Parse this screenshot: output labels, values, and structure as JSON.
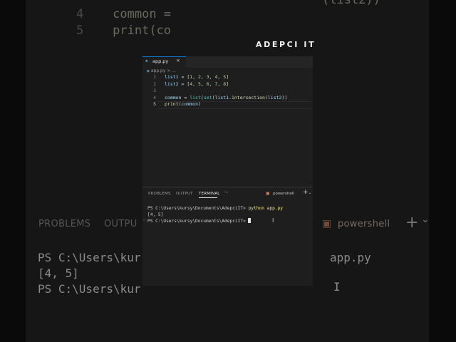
{
  "background": {
    "code_lines": [
      {
        "number": "4",
        "text": "common = "
      },
      {
        "number": "5",
        "text": "print(co"
      }
    ],
    "code_tail": "(list2))",
    "panel_tabs": [
      "PROBLEMS",
      "OUTPU"
    ],
    "powershell_label": "powershell",
    "plus_label": "+",
    "chevron": "⌄",
    "terminal_lines": [
      "PS C:\\Users\\kur",
      "[4, 5]",
      "PS C:\\Users\\kur"
    ],
    "terminal_tail": "app.py",
    "ibeam": "I"
  },
  "watermark": "ADEPCI IT",
  "editor": {
    "tab": {
      "icon": "python-file-icon",
      "label": "app.py",
      "close": "×"
    },
    "breadcrumb": {
      "file": "app.py",
      "rest": "> ..."
    },
    "lines": [
      {
        "number": "1",
        "parts": [
          [
            "var",
            "list1"
          ],
          [
            "op",
            " = ["
          ],
          [
            "num",
            "1"
          ],
          [
            "op",
            ", "
          ],
          [
            "num",
            "2"
          ],
          [
            "op",
            ", "
          ],
          [
            "num",
            "3"
          ],
          [
            "op",
            ", "
          ],
          [
            "num",
            "4"
          ],
          [
            "op",
            ", "
          ],
          [
            "num",
            "5"
          ],
          [
            "op",
            "]"
          ]
        ]
      },
      {
        "number": "2",
        "parts": [
          [
            "var",
            "list2"
          ],
          [
            "op",
            " = ["
          ],
          [
            "num",
            "4"
          ],
          [
            "op",
            ", "
          ],
          [
            "num",
            "5"
          ],
          [
            "op",
            ", "
          ],
          [
            "num",
            "6"
          ],
          [
            "op",
            ", "
          ],
          [
            "num",
            "7"
          ],
          [
            "op",
            ", "
          ],
          [
            "num",
            "8"
          ],
          [
            "op",
            "]"
          ]
        ]
      },
      {
        "number": "3",
        "parts": []
      },
      {
        "number": "4",
        "parts": [
          [
            "var",
            "common"
          ],
          [
            "op",
            " = "
          ],
          [
            "cls",
            "list"
          ],
          [
            "op",
            "("
          ],
          [
            "cls",
            "set"
          ],
          [
            "op",
            "("
          ],
          [
            "var",
            "list1"
          ],
          [
            "op",
            "."
          ],
          [
            "fn",
            "intersection"
          ],
          [
            "op",
            "("
          ],
          [
            "var",
            "list2"
          ],
          [
            "op",
            "))"
          ]
        ]
      },
      {
        "number": "5",
        "parts": [
          [
            "fn",
            "print"
          ],
          [
            "op",
            "("
          ],
          [
            "var",
            "common"
          ],
          [
            "op",
            ")"
          ]
        ]
      }
    ],
    "active_line": 5
  },
  "panel": {
    "tabs": [
      "PROBLEMS",
      "OUTPUT",
      "TERMINAL"
    ],
    "active_tab": "TERMINAL",
    "more": "···",
    "shell_label": "powershell",
    "plus": "+",
    "chevron": "⌄",
    "terminal": {
      "line1_prompt": "PS C:\\Users\\kursy\\Documents\\AdepciIT>",
      "line1_cmd": "python app.py",
      "line2": "[4, 5]",
      "line3_prompt": "PS C:\\Users\\kursy\\Documents\\AdepciIT>"
    },
    "ibeam": "I"
  }
}
